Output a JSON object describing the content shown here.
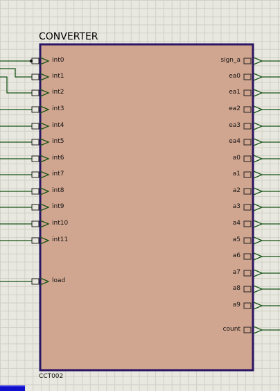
{
  "component": {
    "title": "CONVERTER",
    "reference": "CCT002",
    "body_color": "#d1a690",
    "border_color": "#2a1464"
  },
  "wire_color": "#155215",
  "input_pins": [
    "int0",
    "int1",
    "int2",
    "int3",
    "int4",
    "int5",
    "int6",
    "int7",
    "int8",
    "int9",
    "int10",
    "int11",
    "load"
  ],
  "output_pins": [
    "sign_a",
    "ea0",
    "ea1",
    "ea2",
    "ea3",
    "ea4",
    "a0",
    "a1",
    "a2",
    "a3",
    "a4",
    "a5",
    "a6",
    "a7",
    "a8",
    "a9",
    "count"
  ]
}
